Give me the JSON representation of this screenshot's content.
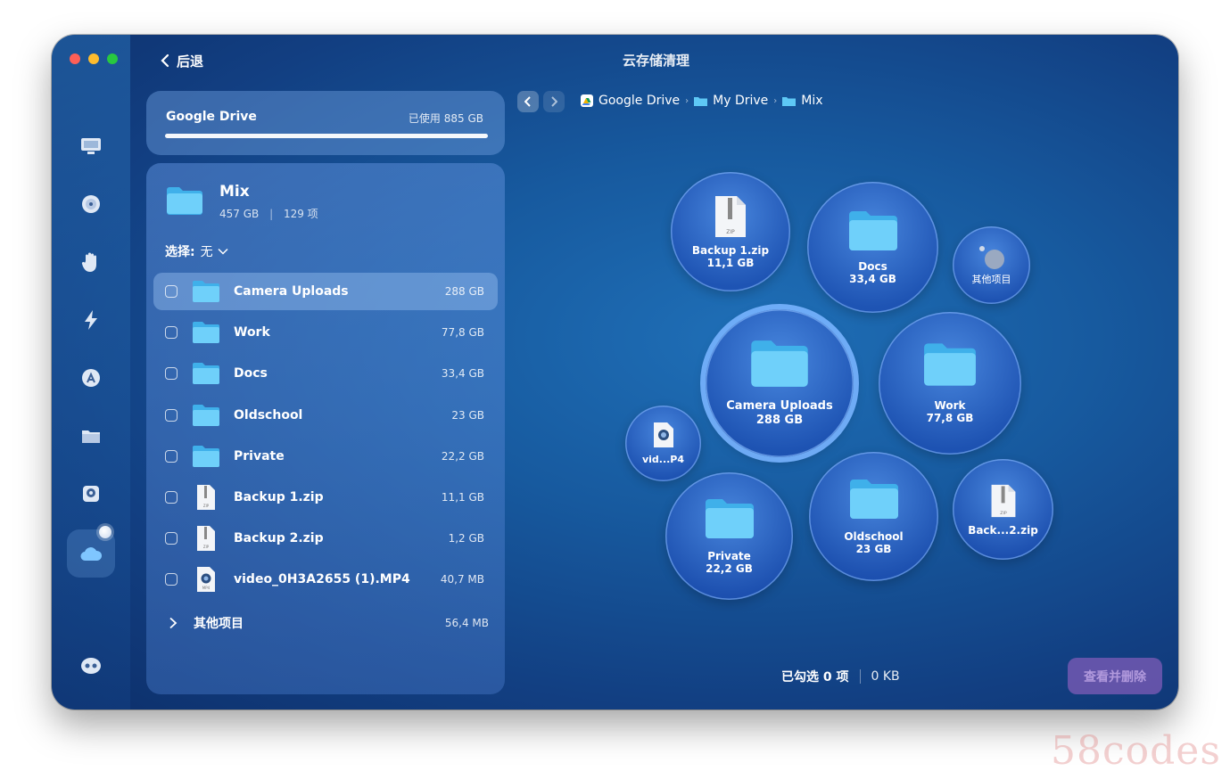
{
  "window": {
    "title": "云存储清理",
    "back_label": "后退"
  },
  "drive": {
    "name": "Google Drive",
    "used_label": "已使用 885 GB"
  },
  "current_folder": {
    "name": "Mix",
    "size": "457 GB",
    "sep": "|",
    "count": "129 项"
  },
  "select": {
    "label": "选择:",
    "value": "无"
  },
  "files": [
    {
      "name": "Camera Uploads",
      "size": "288 GB",
      "icon": "folder-icon",
      "selected": true
    },
    {
      "name": "Work",
      "size": "77,8 GB",
      "icon": "folder-icon"
    },
    {
      "name": "Docs",
      "size": "33,4 GB",
      "icon": "folder-icon"
    },
    {
      "name": "Oldschool",
      "size": "23 GB",
      "icon": "folder-icon"
    },
    {
      "name": "Private",
      "size": "22,2 GB",
      "icon": "folder-icon"
    },
    {
      "name": "Backup 1.zip",
      "size": "11,1 GB",
      "icon": "zip-icon"
    },
    {
      "name": "Backup 2.zip",
      "size": "1,2 GB",
      "icon": "zip-icon"
    },
    {
      "name": "video_0H3A2655 (1).MP4",
      "size": "40,7 MB",
      "icon": "video-icon"
    }
  ],
  "other_items": {
    "label": "其他项目",
    "size": "56,4 MB"
  },
  "breadcrumb": [
    "Google Drive",
    "My Drive",
    "Mix"
  ],
  "bubbles": {
    "backup1": {
      "label": "Backup 1.zip",
      "size": "11,1 GB"
    },
    "docs": {
      "label": "Docs",
      "size": "33,4 GB"
    },
    "other": {
      "label": "其他项目"
    },
    "camera": {
      "label": "Camera Uploads",
      "size": "288 GB"
    },
    "work": {
      "label": "Work",
      "size": "77,8 GB"
    },
    "video": {
      "label": "vid...P4"
    },
    "private": {
      "label": "Private",
      "size": "22,2 GB"
    },
    "oldschool": {
      "label": "Oldschool",
      "size": "23 GB"
    },
    "backup2": {
      "label": "Back...2.zip"
    }
  },
  "footer": {
    "selected_label": "已勾选 0 项",
    "selected_size": "0 KB",
    "delete_label": "查看并删除"
  },
  "watermark": "58codes",
  "colors": {
    "folder": "#5ec8f5",
    "accent_ring": "#78b4ff",
    "delete_button": "#7a5ab4"
  }
}
